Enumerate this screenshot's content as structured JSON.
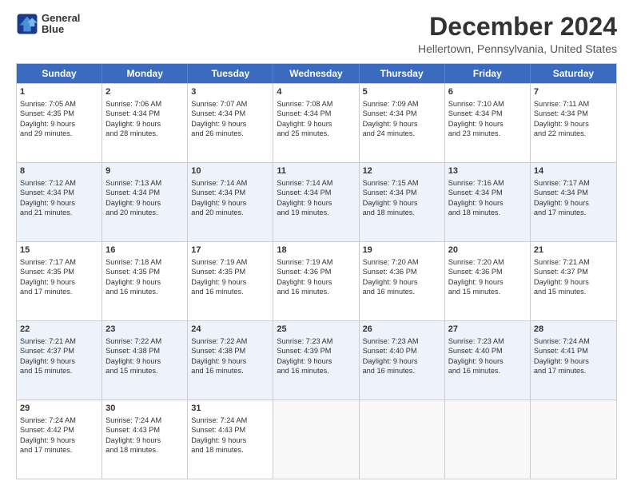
{
  "logo": {
    "line1": "General",
    "line2": "Blue"
  },
  "title": "December 2024",
  "subtitle": "Hellertown, Pennsylvania, United States",
  "header_days": [
    "Sunday",
    "Monday",
    "Tuesday",
    "Wednesday",
    "Thursday",
    "Friday",
    "Saturday"
  ],
  "rows": [
    [
      {
        "day": "1",
        "lines": [
          "Sunrise: 7:05 AM",
          "Sunset: 4:35 PM",
          "Daylight: 9 hours",
          "and 29 minutes."
        ]
      },
      {
        "day": "2",
        "lines": [
          "Sunrise: 7:06 AM",
          "Sunset: 4:34 PM",
          "Daylight: 9 hours",
          "and 28 minutes."
        ]
      },
      {
        "day": "3",
        "lines": [
          "Sunrise: 7:07 AM",
          "Sunset: 4:34 PM",
          "Daylight: 9 hours",
          "and 26 minutes."
        ]
      },
      {
        "day": "4",
        "lines": [
          "Sunrise: 7:08 AM",
          "Sunset: 4:34 PM",
          "Daylight: 9 hours",
          "and 25 minutes."
        ]
      },
      {
        "day": "5",
        "lines": [
          "Sunrise: 7:09 AM",
          "Sunset: 4:34 PM",
          "Daylight: 9 hours",
          "and 24 minutes."
        ]
      },
      {
        "day": "6",
        "lines": [
          "Sunrise: 7:10 AM",
          "Sunset: 4:34 PM",
          "Daylight: 9 hours",
          "and 23 minutes."
        ]
      },
      {
        "day": "7",
        "lines": [
          "Sunrise: 7:11 AM",
          "Sunset: 4:34 PM",
          "Daylight: 9 hours",
          "and 22 minutes."
        ]
      }
    ],
    [
      {
        "day": "8",
        "lines": [
          "Sunrise: 7:12 AM",
          "Sunset: 4:34 PM",
          "Daylight: 9 hours",
          "and 21 minutes."
        ]
      },
      {
        "day": "9",
        "lines": [
          "Sunrise: 7:13 AM",
          "Sunset: 4:34 PM",
          "Daylight: 9 hours",
          "and 20 minutes."
        ]
      },
      {
        "day": "10",
        "lines": [
          "Sunrise: 7:14 AM",
          "Sunset: 4:34 PM",
          "Daylight: 9 hours",
          "and 20 minutes."
        ]
      },
      {
        "day": "11",
        "lines": [
          "Sunrise: 7:14 AM",
          "Sunset: 4:34 PM",
          "Daylight: 9 hours",
          "and 19 minutes."
        ]
      },
      {
        "day": "12",
        "lines": [
          "Sunrise: 7:15 AM",
          "Sunset: 4:34 PM",
          "Daylight: 9 hours",
          "and 18 minutes."
        ]
      },
      {
        "day": "13",
        "lines": [
          "Sunrise: 7:16 AM",
          "Sunset: 4:34 PM",
          "Daylight: 9 hours",
          "and 18 minutes."
        ]
      },
      {
        "day": "14",
        "lines": [
          "Sunrise: 7:17 AM",
          "Sunset: 4:34 PM",
          "Daylight: 9 hours",
          "and 17 minutes."
        ]
      }
    ],
    [
      {
        "day": "15",
        "lines": [
          "Sunrise: 7:17 AM",
          "Sunset: 4:35 PM",
          "Daylight: 9 hours",
          "and 17 minutes."
        ]
      },
      {
        "day": "16",
        "lines": [
          "Sunrise: 7:18 AM",
          "Sunset: 4:35 PM",
          "Daylight: 9 hours",
          "and 16 minutes."
        ]
      },
      {
        "day": "17",
        "lines": [
          "Sunrise: 7:19 AM",
          "Sunset: 4:35 PM",
          "Daylight: 9 hours",
          "and 16 minutes."
        ]
      },
      {
        "day": "18",
        "lines": [
          "Sunrise: 7:19 AM",
          "Sunset: 4:36 PM",
          "Daylight: 9 hours",
          "and 16 minutes."
        ]
      },
      {
        "day": "19",
        "lines": [
          "Sunrise: 7:20 AM",
          "Sunset: 4:36 PM",
          "Daylight: 9 hours",
          "and 16 minutes."
        ]
      },
      {
        "day": "20",
        "lines": [
          "Sunrise: 7:20 AM",
          "Sunset: 4:36 PM",
          "Daylight: 9 hours",
          "and 15 minutes."
        ]
      },
      {
        "day": "21",
        "lines": [
          "Sunrise: 7:21 AM",
          "Sunset: 4:37 PM",
          "Daylight: 9 hours",
          "and 15 minutes."
        ]
      }
    ],
    [
      {
        "day": "22",
        "lines": [
          "Sunrise: 7:21 AM",
          "Sunset: 4:37 PM",
          "Daylight: 9 hours",
          "and 15 minutes."
        ]
      },
      {
        "day": "23",
        "lines": [
          "Sunrise: 7:22 AM",
          "Sunset: 4:38 PM",
          "Daylight: 9 hours",
          "and 15 minutes."
        ]
      },
      {
        "day": "24",
        "lines": [
          "Sunrise: 7:22 AM",
          "Sunset: 4:38 PM",
          "Daylight: 9 hours",
          "and 16 minutes."
        ]
      },
      {
        "day": "25",
        "lines": [
          "Sunrise: 7:23 AM",
          "Sunset: 4:39 PM",
          "Daylight: 9 hours",
          "and 16 minutes."
        ]
      },
      {
        "day": "26",
        "lines": [
          "Sunrise: 7:23 AM",
          "Sunset: 4:40 PM",
          "Daylight: 9 hours",
          "and 16 minutes."
        ]
      },
      {
        "day": "27",
        "lines": [
          "Sunrise: 7:23 AM",
          "Sunset: 4:40 PM",
          "Daylight: 9 hours",
          "and 16 minutes."
        ]
      },
      {
        "day": "28",
        "lines": [
          "Sunrise: 7:24 AM",
          "Sunset: 4:41 PM",
          "Daylight: 9 hours",
          "and 17 minutes."
        ]
      }
    ],
    [
      {
        "day": "29",
        "lines": [
          "Sunrise: 7:24 AM",
          "Sunset: 4:42 PM",
          "Daylight: 9 hours",
          "and 17 minutes."
        ]
      },
      {
        "day": "30",
        "lines": [
          "Sunrise: 7:24 AM",
          "Sunset: 4:43 PM",
          "Daylight: 9 hours",
          "and 18 minutes."
        ]
      },
      {
        "day": "31",
        "lines": [
          "Sunrise: 7:24 AM",
          "Sunset: 4:43 PM",
          "Daylight: 9 hours",
          "and 18 minutes."
        ]
      },
      null,
      null,
      null,
      null
    ]
  ]
}
